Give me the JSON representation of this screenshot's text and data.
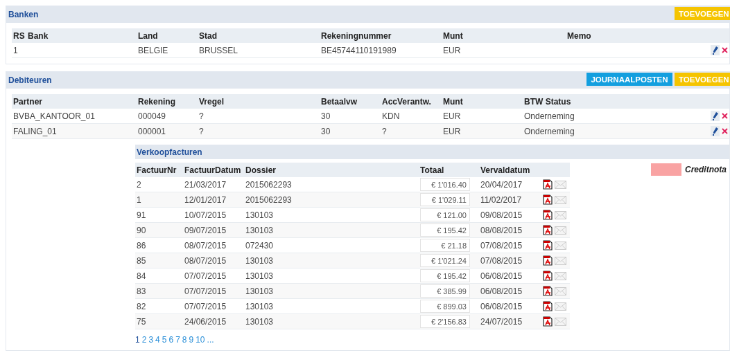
{
  "banken": {
    "title": "Banken",
    "buttons": [
      {
        "kind": "add",
        "label": "TOEVOEGEN"
      }
    ],
    "columns": [
      "RS",
      "Bank",
      "Land",
      "Stad",
      "Rekeningnummer",
      "Munt",
      "Memo"
    ],
    "rows": [
      {
        "rs": "1",
        "land": "BELGIE",
        "stad": "BRUSSEL",
        "rekeningnummer": "BE45744110191989",
        "munt": "EUR"
      }
    ]
  },
  "debiteuren": {
    "title": "Debiteuren",
    "buttons": [
      {
        "kind": "journal",
        "label": "JOURNAALPOSTEN"
      },
      {
        "kind": "add",
        "label": "TOEVOEGEN"
      }
    ],
    "columns": [
      "Partner",
      "Rekening",
      "Vregel",
      "Betaalvw",
      "AccVerantw.",
      "Munt",
      "BTW Status"
    ],
    "rows": [
      {
        "partner": "BVBA_KANTOOR_01",
        "rekening": "000049",
        "vregel": "?",
        "betaalvw": "30",
        "accverantw": "KDN",
        "munt": "EUR",
        "btw_status": "Onderneming"
      },
      {
        "partner": "FALING_01",
        "rekening": "000001",
        "vregel": "?",
        "betaalvw": "30",
        "accverantw": "?",
        "munt": "EUR",
        "btw_status": "Onderneming"
      }
    ]
  },
  "verkoopfacturen": {
    "title": "Verkoopfacturen",
    "columns": [
      "FactuurNr",
      "FactuurDatum",
      "Dossier",
      "Totaal",
      "Vervaldatum"
    ],
    "rows": [
      {
        "nr": "2",
        "datum": "21/03/2017",
        "dossier": "2015062293",
        "totaal": "€ 1'016.40",
        "vervaldatum": "20/04/2017"
      },
      {
        "nr": "1",
        "datum": "12/01/2017",
        "dossier": "2015062293",
        "totaal": "€ 1'029.11",
        "vervaldatum": "11/02/2017"
      },
      {
        "nr": "91",
        "datum": "10/07/2015",
        "dossier": "130103",
        "totaal": "€ 121.00",
        "vervaldatum": "09/08/2015"
      },
      {
        "nr": "90",
        "datum": "09/07/2015",
        "dossier": "130103",
        "totaal": "€ 195.42",
        "vervaldatum": "08/08/2015"
      },
      {
        "nr": "86",
        "datum": "08/07/2015",
        "dossier": "072430",
        "totaal": "€ 21.18",
        "vervaldatum": "07/08/2015"
      },
      {
        "nr": "85",
        "datum": "08/07/2015",
        "dossier": "130103",
        "totaal": "€ 1'021.24",
        "vervaldatum": "07/08/2015"
      },
      {
        "nr": "84",
        "datum": "07/07/2015",
        "dossier": "130103",
        "totaal": "€ 195.42",
        "vervaldatum": "06/08/2015"
      },
      {
        "nr": "83",
        "datum": "07/07/2015",
        "dossier": "130103",
        "totaal": "€ 385.99",
        "vervaldatum": "06/08/2015"
      },
      {
        "nr": "82",
        "datum": "07/07/2015",
        "dossier": "130103",
        "totaal": "€ 899.03",
        "vervaldatum": "06/08/2015"
      },
      {
        "nr": "75",
        "datum": "24/06/2015",
        "dossier": "130103",
        "totaal": "€ 2'156.83",
        "vervaldatum": "24/07/2015"
      }
    ],
    "pages": [
      {
        "label": "1",
        "selected": true
      },
      {
        "label": "2",
        "selected": false
      },
      {
        "label": "3",
        "selected": false
      },
      {
        "label": "4",
        "selected": false
      },
      {
        "label": "5",
        "selected": false
      },
      {
        "label": "6",
        "selected": false
      },
      {
        "label": "7",
        "selected": false
      },
      {
        "label": "8",
        "selected": false
      },
      {
        "label": "9",
        "selected": false
      },
      {
        "label": "10",
        "selected": false
      },
      {
        "label": "...",
        "selected": false
      }
    ],
    "legend": [
      {
        "label": "Creditnota",
        "color": "#f9a3a3"
      }
    ]
  }
}
